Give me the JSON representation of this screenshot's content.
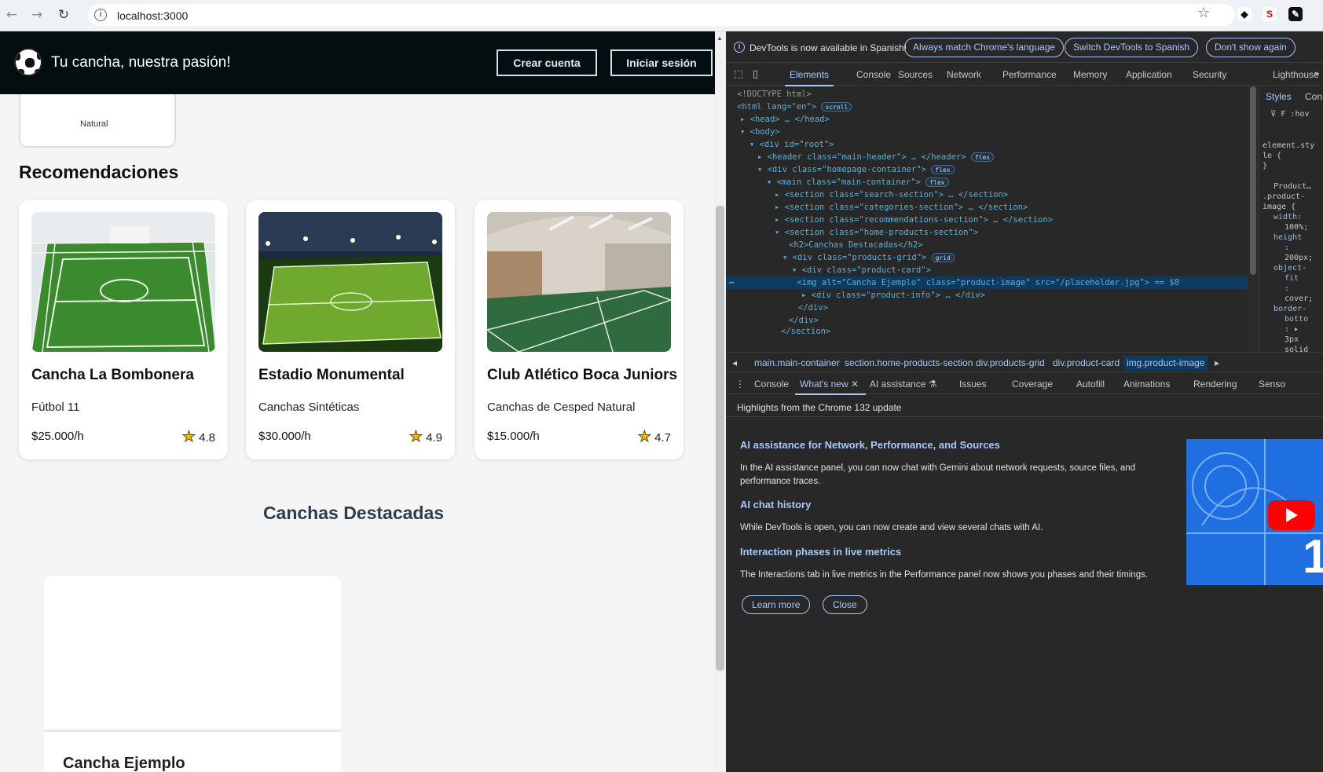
{
  "browser": {
    "url": "localhost:3000"
  },
  "header": {
    "brand": "Tu cancha, nuestra pasión!",
    "create_account": "Crear cuenta",
    "login": "Iniciar sesión"
  },
  "category_card_partial": "Natural",
  "recommendations": {
    "title": "Recomendaciones",
    "cards": [
      {
        "name": "Cancha La Bombonera",
        "category": "Fútbol 11",
        "price": "$25.000/h",
        "rating": "4.8"
      },
      {
        "name": "Estadio Monumental",
        "category": "Canchas Sintéticas",
        "price": "$30.000/h",
        "rating": "4.9"
      },
      {
        "name": "Club Atlético Boca Juniors",
        "category": "Canchas de Cesped Natural",
        "price": "$15.000/h",
        "rating": "4.7"
      }
    ]
  },
  "featured": {
    "title": "Canchas Destacadas",
    "card_name": "Cancha Ejemplo"
  },
  "devtools": {
    "banner": {
      "message": "DevTools is now available in Spanish!",
      "btn_match": "Always match Chrome's language",
      "btn_switch": "Switch DevTools to Spanish",
      "btn_dismiss": "Don't show again"
    },
    "tabs": [
      "Elements",
      "Console",
      "Sources",
      "Network",
      "Performance",
      "Memory",
      "Application",
      "Security",
      "Lighthouse"
    ],
    "styles_tabs": [
      "Styles",
      "Con"
    ],
    "styles_filter": "F",
    "styles_hov": ":hov",
    "styles_lines": [
      "element.sty",
      "le {",
      "}",
      "Product…",
      ".product-",
      "image {",
      "width:",
      "100%;",
      "height",
      ":",
      "200px;",
      "object-",
      "fit",
      ":",
      "cover;",
      "border-",
      "botto",
      ": ▸",
      "3px",
      "solid"
    ],
    "dom_lines": [
      "<!DOCTYPE html>",
      "<html lang=\"en\">",
      "<head>",
      "<body>",
      "<div id=\"root\">",
      "<header class=\"main-header\">",
      "<div class=\"homepage-container\">",
      "<main class=\"main-container\">",
      "<section class=\"search-section\">",
      "<section class=\"categories-section\">",
      "<section class=\"recommendations-section\">",
      "<section class=\"home-products-section\">",
      "<h2>Canchas Destacadas</h2>",
      "<div class=\"products-grid\">",
      "<div class=\"product-card\">",
      "<img alt=\"Cancha Ejemplo\" class=\"product-image\" src=\"/placeholder.jpg\"> == $0",
      "<div class=\"product-info\">",
      "</div>",
      "</div>",
      "</section>"
    ],
    "pills": [
      "scroll",
      "flex",
      "flex",
      "flex",
      "grid"
    ],
    "breadcrumbs": [
      "main.main-container",
      "section.home-products-section",
      "div.products-grid",
      "div.product-card",
      "img.product-image"
    ],
    "drawer_tabs": [
      "Console",
      "What's new",
      "AI assistance",
      "Issues",
      "Coverage",
      "Autofill",
      "Animations",
      "Rendering",
      "Senso"
    ],
    "whats_new": {
      "heading": "Highlights from the Chrome 132 update",
      "items": [
        {
          "title": "AI assistance for Network, Performance, and Sources",
          "text": "In the AI assistance panel, you can now chat with Gemini about network requests, source files, and performance traces."
        },
        {
          "title": "AI chat history",
          "text": "While DevTools is open, you can now create and view several chats with AI."
        },
        {
          "title": "Interaction phases in live metrics",
          "text": "The Interactions tab in live metrics in the Performance panel now shows you phases and their timings."
        }
      ],
      "learn_more": "Learn more",
      "close": "Close"
    }
  }
}
